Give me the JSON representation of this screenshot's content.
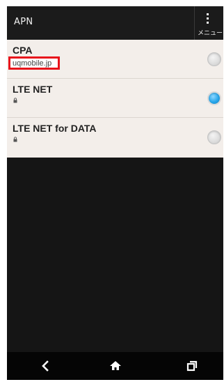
{
  "action_bar": {
    "title": "APN",
    "menu_label": "メニュー",
    "menu_icon": "more-vert-icon"
  },
  "apn_list": {
    "items": [
      {
        "name": "CPA",
        "detail": "uqmobile.jp",
        "locked": false,
        "selected": false,
        "highlighted": true
      },
      {
        "name": "LTE NET",
        "detail": "",
        "locked": true,
        "selected": true,
        "highlighted": false
      },
      {
        "name": "LTE NET for DATA",
        "detail": "",
        "locked": true,
        "selected": false,
        "highlighted": false
      }
    ]
  },
  "nav_bar": {
    "icons": [
      "back-icon",
      "home-icon",
      "recents-icon"
    ]
  },
  "colors": {
    "list_background": "#f3eeea",
    "radio_selected": "#27a6ea",
    "highlight_box": "#e8131b",
    "action_bar": "#1b1b1b"
  }
}
